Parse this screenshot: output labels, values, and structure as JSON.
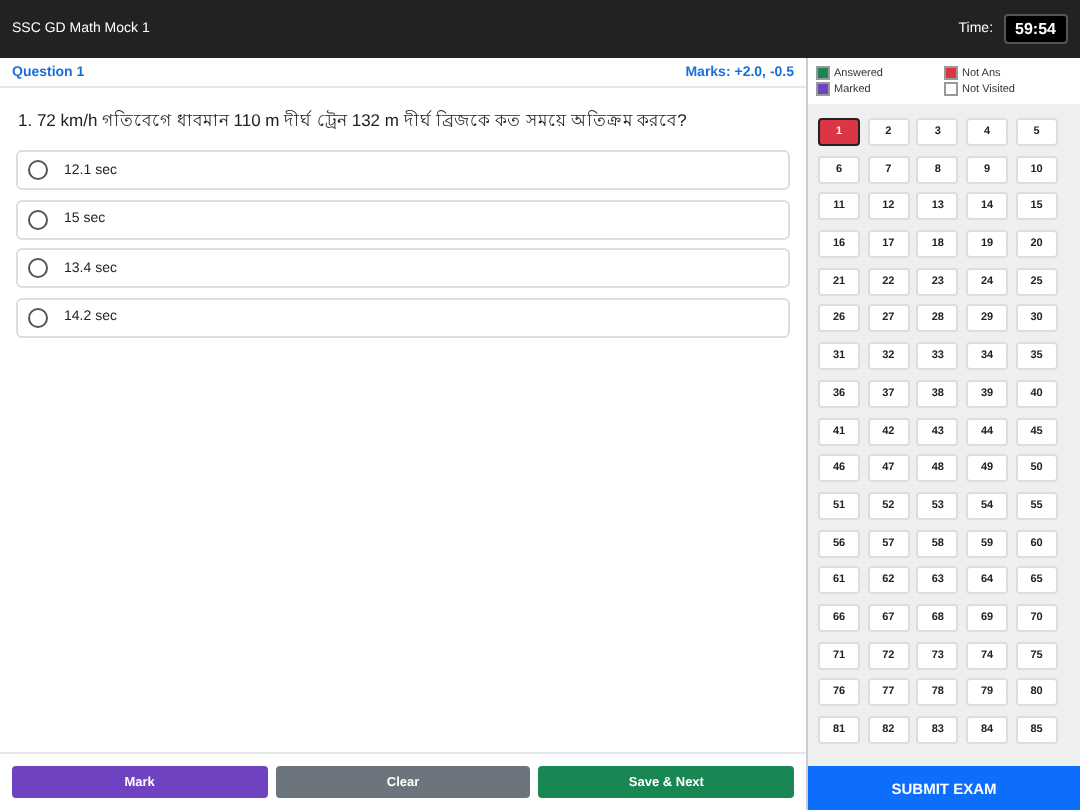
{
  "header": {
    "title": "SSC GD Math Mock 1",
    "timer_label": "Time:",
    "timer": "59:54"
  },
  "question": {
    "label": "Question 1",
    "marks": "Marks: +2.0, -0.5",
    "text": "1. 72 km/h গতিবেগে ধাবমান 110 m দীর্ঘ ট্রেন 132 m দীর্ঘ ব্রিজকে কত সময়ে অতিক্রম করবে?",
    "options": [
      {
        "label": "12.1 sec",
        "selected": false
      },
      {
        "label": "15 sec",
        "selected": false
      },
      {
        "label": "13.4 sec",
        "selected": false
      },
      {
        "label": "14.2 sec",
        "selected": false
      }
    ]
  },
  "legend": [
    {
      "label": "Answered",
      "color": "#198754"
    },
    {
      "label": "Not Ans",
      "color": "#dc3545"
    },
    {
      "label": "Marked",
      "color": "#6f42c1"
    },
    {
      "label": "Not Visited",
      "color": "#ffffff"
    }
  ],
  "palette": [
    {
      "number": "1",
      "color": "#dc3545",
      "selected": true
    },
    {
      "number": "2",
      "color": "#ffffff",
      "selected": false
    },
    {
      "number": "3",
      "color": "#ffffff",
      "selected": false
    },
    {
      "number": "4",
      "color": "#ffffff",
      "selected": false
    },
    {
      "number": "5",
      "color": "#ffffff",
      "selected": false
    },
    {
      "number": "6",
      "color": "#ffffff",
      "selected": false
    },
    {
      "number": "7",
      "color": "#ffffff",
      "selected": false
    },
    {
      "number": "8",
      "color": "#ffffff",
      "selected": false
    },
    {
      "number": "9",
      "color": "#ffffff",
      "selected": false
    },
    {
      "number": "10",
      "color": "#ffffff",
      "selected": false
    },
    {
      "number": "11",
      "color": "#ffffff",
      "selected": false
    },
    {
      "number": "12",
      "color": "#ffffff",
      "selected": false
    },
    {
      "number": "13",
      "color": "#ffffff",
      "selected": false
    },
    {
      "number": "14",
      "color": "#ffffff",
      "selected": false
    },
    {
      "number": "15",
      "color": "#ffffff",
      "selected": false
    },
    {
      "number": "16",
      "color": "#ffffff",
      "selected": false
    },
    {
      "number": "17",
      "color": "#ffffff",
      "selected": false
    },
    {
      "number": "18",
      "color": "#ffffff",
      "selected": false
    },
    {
      "number": "19",
      "color": "#ffffff",
      "selected": false
    },
    {
      "number": "20",
      "color": "#ffffff",
      "selected": false
    },
    {
      "number": "21",
      "color": "#ffffff",
      "selected": false
    },
    {
      "number": "22",
      "color": "#ffffff",
      "selected": false
    },
    {
      "number": "23",
      "color": "#ffffff",
      "selected": false
    },
    {
      "number": "24",
      "color": "#ffffff",
      "selected": false
    },
    {
      "number": "25",
      "color": "#ffffff",
      "selected": false
    },
    {
      "number": "26",
      "color": "#ffffff",
      "selected": false
    },
    {
      "number": "27",
      "color": "#ffffff",
      "selected": false
    },
    {
      "number": "28",
      "color": "#ffffff",
      "selected": false
    },
    {
      "number": "29",
      "color": "#ffffff",
      "selected": false
    },
    {
      "number": "30",
      "color": "#ffffff",
      "selected": false
    },
    {
      "number": "31",
      "color": "#ffffff",
      "selected": false
    },
    {
      "number": "32",
      "color": "#ffffff",
      "selected": false
    },
    {
      "number": "33",
      "color": "#ffffff",
      "selected": false
    },
    {
      "number": "34",
      "color": "#ffffff",
      "selected": false
    },
    {
      "number": "35",
      "color": "#ffffff",
      "selected": false
    },
    {
      "number": "36",
      "color": "#ffffff",
      "selected": false
    },
    {
      "number": "37",
      "color": "#ffffff",
      "selected": false
    },
    {
      "number": "38",
      "color": "#ffffff",
      "selected": false
    },
    {
      "number": "39",
      "color": "#ffffff",
      "selected": false
    },
    {
      "number": "40",
      "color": "#ffffff",
      "selected": false
    },
    {
      "number": "41",
      "color": "#ffffff",
      "selected": false
    },
    {
      "number": "42",
      "color": "#ffffff",
      "selected": false
    },
    {
      "number": "43",
      "color": "#ffffff",
      "selected": false
    },
    {
      "number": "44",
      "color": "#ffffff",
      "selected": false
    },
    {
      "number": "45",
      "color": "#ffffff",
      "selected": false
    },
    {
      "number": "46",
      "color": "#ffffff",
      "selected": false
    },
    {
      "number": "47",
      "color": "#ffffff",
      "selected": false
    },
    {
      "number": "48",
      "color": "#ffffff",
      "selected": false
    },
    {
      "number": "49",
      "color": "#ffffff",
      "selected": false
    },
    {
      "number": "50",
      "color": "#ffffff",
      "selected": false
    },
    {
      "number": "51",
      "color": "#ffffff",
      "selected": false
    },
    {
      "number": "52",
      "color": "#ffffff",
      "selected": false
    },
    {
      "number": "53",
      "color": "#ffffff",
      "selected": false
    },
    {
      "number": "54",
      "color": "#ffffff",
      "selected": false
    },
    {
      "number": "55",
      "color": "#ffffff",
      "selected": false
    },
    {
      "number": "56",
      "color": "#ffffff",
      "selected": false
    },
    {
      "number": "57",
      "color": "#ffffff",
      "selected": false
    },
    {
      "number": "58",
      "color": "#ffffff",
      "selected": false
    },
    {
      "number": "59",
      "color": "#ffffff",
      "selected": false
    },
    {
      "number": "60",
      "color": "#ffffff",
      "selected": false
    },
    {
      "number": "61",
      "color": "#ffffff",
      "selected": false
    },
    {
      "number": "62",
      "color": "#ffffff",
      "selected": false
    },
    {
      "number": "63",
      "color": "#ffffff",
      "selected": false
    },
    {
      "number": "64",
      "color": "#ffffff",
      "selected": false
    },
    {
      "number": "65",
      "color": "#ffffff",
      "selected": false
    },
    {
      "number": "66",
      "color": "#ffffff",
      "selected": false
    },
    {
      "number": "67",
      "color": "#ffffff",
      "selected": false
    },
    {
      "number": "68",
      "color": "#ffffff",
      "selected": false
    },
    {
      "number": "69",
      "color": "#ffffff",
      "selected": false
    },
    {
      "number": "70",
      "color": "#ffffff",
      "selected": false
    },
    {
      "number": "71",
      "color": "#ffffff",
      "selected": false
    },
    {
      "number": "72",
      "color": "#ffffff",
      "selected": false
    },
    {
      "number": "73",
      "color": "#ffffff",
      "selected": false
    },
    {
      "number": "74",
      "color": "#ffffff",
      "selected": false
    },
    {
      "number": "75",
      "color": "#ffffff",
      "selected": false
    },
    {
      "number": "76",
      "color": "#ffffff",
      "selected": false
    },
    {
      "number": "77",
      "color": "#ffffff",
      "selected": false
    },
    {
      "number": "78",
      "color": "#ffffff",
      "selected": false
    },
    {
      "number": "79",
      "color": "#ffffff",
      "selected": false
    },
    {
      "number": "80",
      "color": "#ffffff",
      "selected": false
    },
    {
      "number": "81",
      "color": "#ffffff",
      "selected": false
    },
    {
      "number": "82",
      "color": "#ffffff",
      "selected": false
    },
    {
      "number": "83",
      "color": "#ffffff",
      "selected": false
    },
    {
      "number": "84",
      "color": "#ffffff",
      "selected": false
    },
    {
      "number": "85",
      "color": "#ffffff",
      "selected": false
    }
  ],
  "actions": [
    {
      "label": "Mark",
      "kind": "mark"
    },
    {
      "label": "Clear",
      "kind": "clear"
    },
    {
      "label": "Save & Next",
      "kind": "save"
    }
  ],
  "submit": "SUBMIT EXAM"
}
